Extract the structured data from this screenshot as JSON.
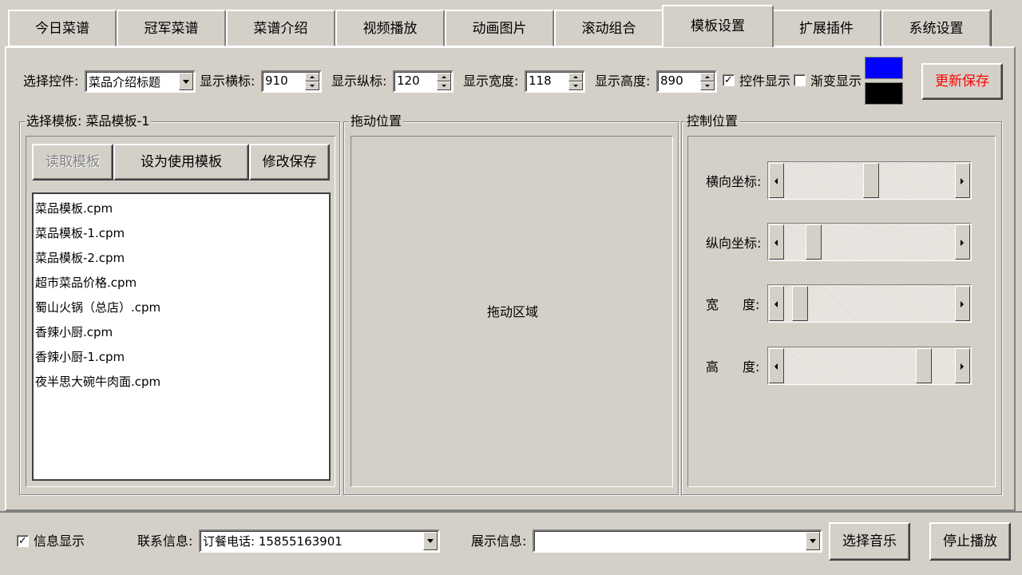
{
  "tabs": [
    {
      "label": "今日菜谱",
      "active": false
    },
    {
      "label": "冠军菜谱",
      "active": false
    },
    {
      "label": "菜谱介绍",
      "active": false
    },
    {
      "label": "视频播放",
      "active": false
    },
    {
      "label": "动画图片",
      "active": false
    },
    {
      "label": "滚动组合",
      "active": false
    },
    {
      "label": "模板设置",
      "active": true
    },
    {
      "label": "扩展插件",
      "active": false
    },
    {
      "label": "系统设置",
      "active": false
    }
  ],
  "toolbar": {
    "select_control_label": "选择控件:",
    "select_control_value": "菜品介绍标题",
    "pos_x_label": "显示横标:",
    "pos_x_value": "910",
    "pos_y_label": "显示纵标:",
    "pos_y_value": "120",
    "width_label": "显示宽度:",
    "width_value": "118",
    "height_label": "显示高度:",
    "height_value": "890",
    "show_control_label": "控件显示",
    "show_control_checked": true,
    "gradient_label": "渐变显示",
    "gradient_checked": false,
    "color_top": "#0000ff",
    "color_bottom": "#000000",
    "update_save_label": "更新保存"
  },
  "template_group": {
    "title": "选择模板: 菜品模板-1",
    "read_label": "读取模板",
    "set_use_label": "设为使用模板",
    "modify_save_label": "修改保存",
    "files": [
      "菜品模板.cpm",
      "菜品模板-1.cpm",
      "菜品模板-2.cpm",
      "超市菜品价格.cpm",
      "蜀山火锅（总店）.cpm",
      "香辣小厨.cpm",
      "香辣小厨-1.cpm",
      "夜半思大碗牛肉面.cpm"
    ]
  },
  "drag_group": {
    "title": "拖动位置",
    "area_label": "拖动区域"
  },
  "control_group": {
    "title": "控制位置",
    "sliders": [
      {
        "label": "横向坐标:",
        "value_fraction": 0.51
      },
      {
        "label": "纵向坐标:",
        "value_fraction": 0.14
      },
      {
        "label_a": "宽",
        "label_b": "度:",
        "value_fraction": 0.05
      },
      {
        "label_a": "高",
        "label_b": "度:",
        "value_fraction": 0.85
      }
    ]
  },
  "bottom": {
    "info_show_label": "信息显示",
    "info_show_checked": true,
    "contact_label": "联系信息:",
    "contact_value": "订餐电话: 15855163901",
    "display_label": "展示信息:",
    "display_value": "",
    "choose_music_label": "选择音乐",
    "stop_play_label": "停止播放"
  }
}
